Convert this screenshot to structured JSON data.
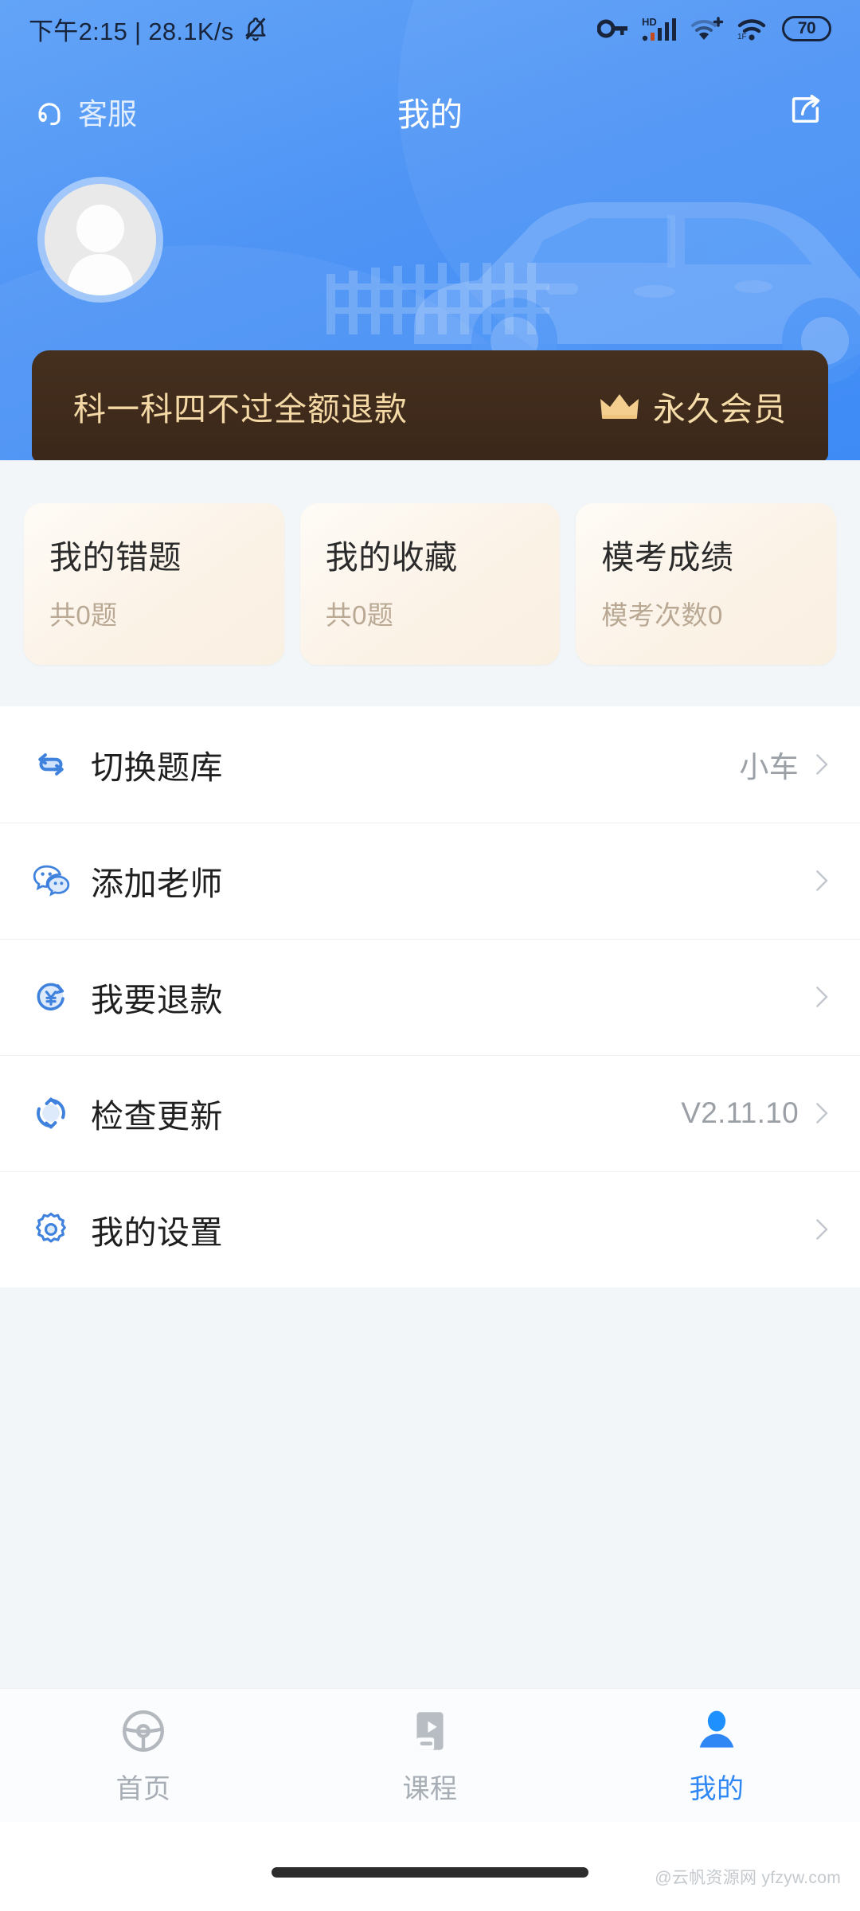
{
  "statusbar": {
    "time_text": "下午2:15 | 28.1K/s",
    "mute_icon": "bell-muted-icon",
    "key_icon": "vpn-key-icon",
    "hd_label": "HD",
    "signal_icon": "signal-bars-icon",
    "wifi_plus_icon": "wifi-plus-icon",
    "wifi_icon": "wifi-icon",
    "battery_level": "70"
  },
  "appbar": {
    "service_label": "客服",
    "service_icon": "headset-icon",
    "title": "我的",
    "share_icon": "share-icon"
  },
  "profile": {
    "avatar_icon": "default-avatar-icon"
  },
  "vip_banner": {
    "promo_text": "科一科四不过全额退款",
    "crown_icon": "crown-icon",
    "member_label": "永久会员"
  },
  "stats": [
    {
      "title": "我的错题",
      "sub": "共0题"
    },
    {
      "title": "我的收藏",
      "sub": "共0题"
    },
    {
      "title": "模考成绩",
      "sub": "模考次数0"
    }
  ],
  "menu": [
    {
      "label": "切换题库",
      "value": "小车",
      "icon": "swap-arrows-icon",
      "chevron": "chevron-right-icon"
    },
    {
      "label": "添加老师",
      "value": "",
      "icon": "wechat-icon",
      "chevron": "chevron-right-icon"
    },
    {
      "label": "我要退款",
      "value": "",
      "icon": "refund-yen-icon",
      "chevron": "chevron-right-icon"
    },
    {
      "label": "检查更新",
      "value": "V2.11.10",
      "icon": "refresh-icon",
      "chevron": "chevron-right-icon"
    },
    {
      "label": "我的设置",
      "value": "",
      "icon": "gear-icon",
      "chevron": "chevron-right-icon"
    }
  ],
  "tabbar": [
    {
      "label": "首页",
      "icon": "steering-wheel-icon",
      "active": false
    },
    {
      "label": "课程",
      "icon": "video-course-icon",
      "active": false
    },
    {
      "label": "我的",
      "icon": "person-icon",
      "active": true
    }
  ],
  "watermark": {
    "text": "@云帆资源网 yfzyw.com"
  },
  "colors": {
    "brand_blue": "#4E94F5",
    "accent_blue": "#2F87F5",
    "banner_brown": "#3B2719",
    "banner_gold": "#F4D9A6",
    "card_cream": "#FBF2E6",
    "page_bg": "#F2F6F9"
  }
}
